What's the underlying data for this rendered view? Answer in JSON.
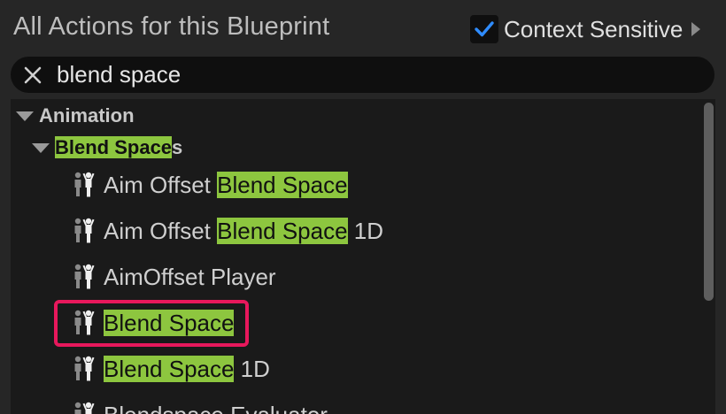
{
  "header": {
    "title": "All Actions for this Blueprint",
    "context_sensitive_label": "Context Sensitive",
    "context_sensitive_checked": true,
    "checkbox_color": "#2f8cff"
  },
  "search": {
    "value": "blend space",
    "placeholder": ""
  },
  "highlight_color": "#8dc63f",
  "selection_outline_color": "#e8185c",
  "tree": {
    "category": "Animation",
    "subcategory": {
      "label_match": "Blend Space",
      "label_rest": "s"
    },
    "items": [
      {
        "pre": "Aim Offset ",
        "match": "Blend Space",
        "post": "",
        "icon": "animation-person-icon"
      },
      {
        "pre": "Aim Offset ",
        "match": "Blend Space",
        "post": " 1D",
        "icon": "animation-person-icon"
      },
      {
        "pre": "AimOffset Player",
        "match": "",
        "post": "",
        "icon": "animation-person-icon"
      },
      {
        "pre": "",
        "match": "Blend Space",
        "post": "",
        "icon": "animation-person-icon",
        "selected": true
      },
      {
        "pre": "",
        "match": "Blend Space",
        "post": " 1D",
        "icon": "animation-person-icon"
      },
      {
        "pre": "Blendspace Evaluator",
        "match": "",
        "post": "",
        "icon": "animation-person-icon"
      }
    ]
  }
}
